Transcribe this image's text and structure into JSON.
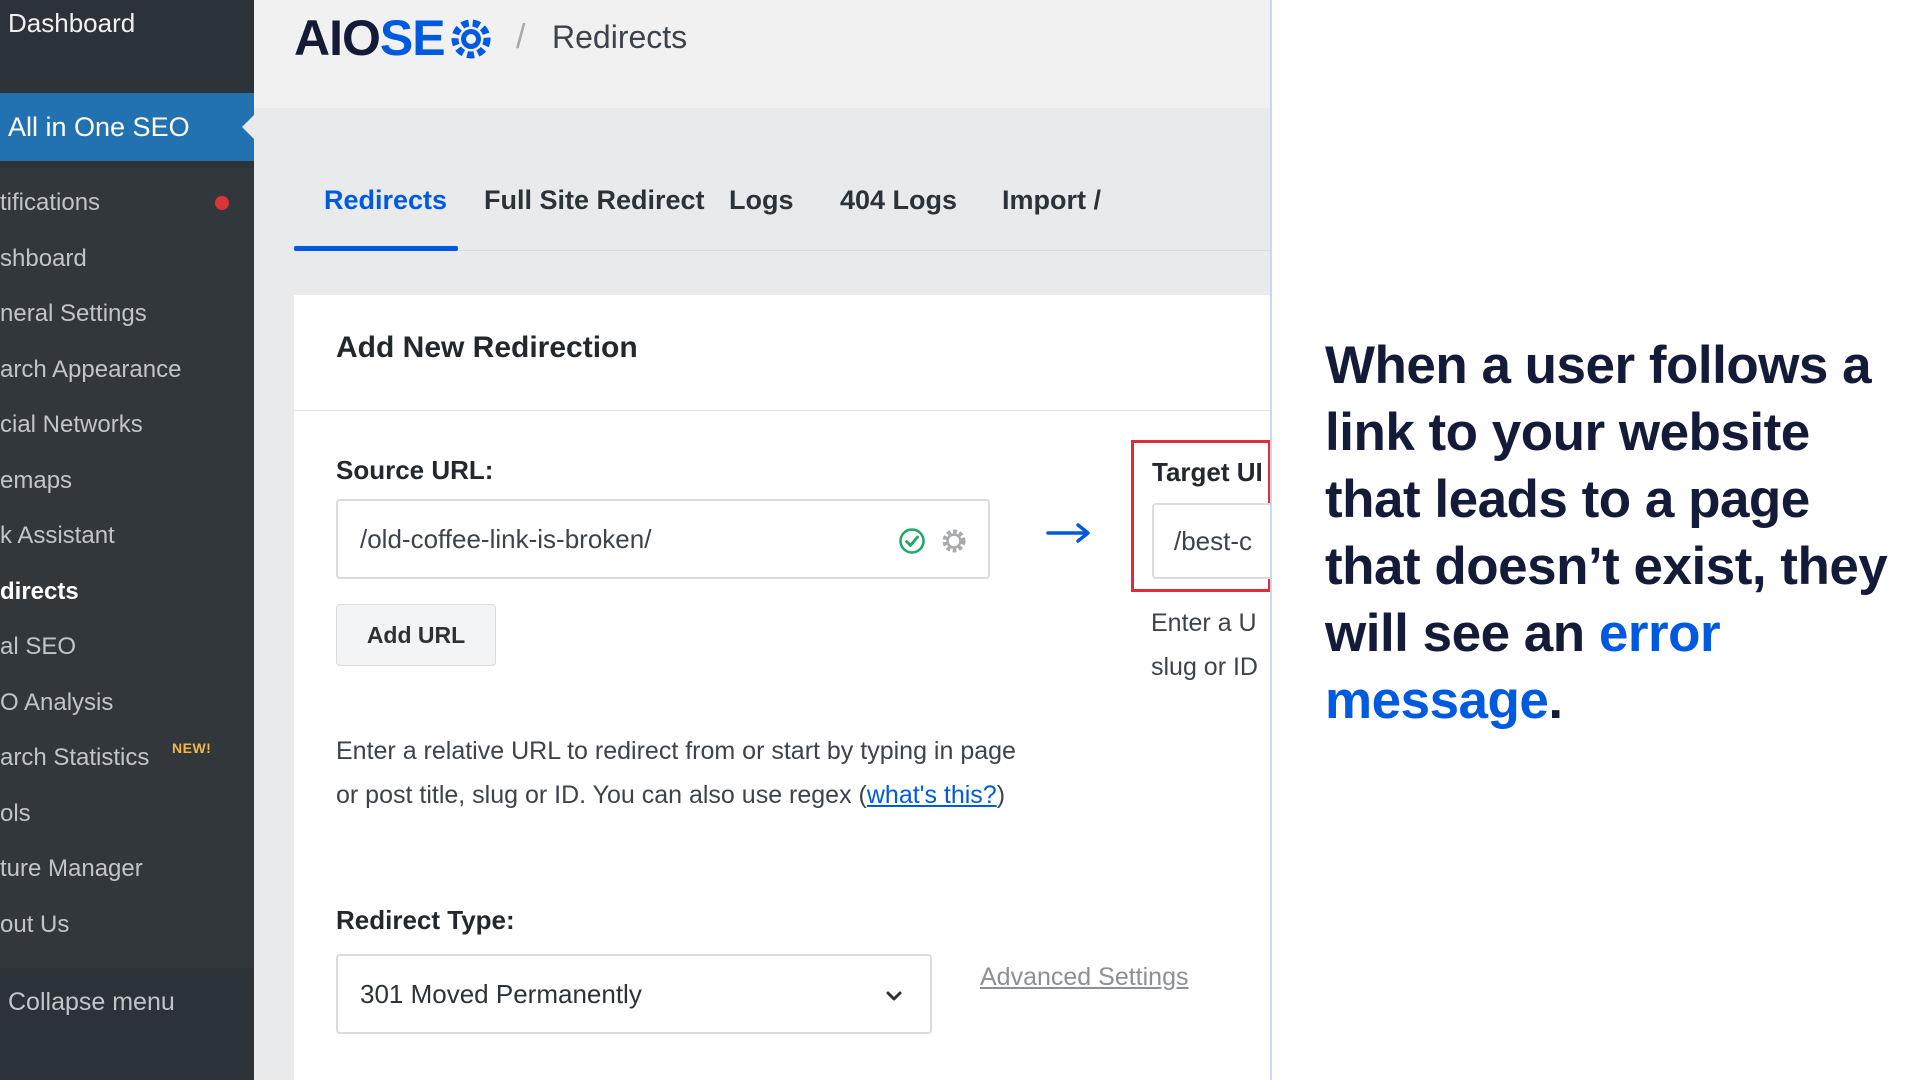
{
  "sidebar": {
    "dashboard": "Dashboard",
    "plugin": "All in One SEO",
    "items": [
      {
        "label": "tifications",
        "dot": true
      },
      {
        "label": "shboard"
      },
      {
        "label": "neral Settings"
      },
      {
        "label": "arch Appearance"
      },
      {
        "label": "cial Networks"
      },
      {
        "label": "emaps"
      },
      {
        "label": "k Assistant"
      },
      {
        "label": "directs",
        "active": true
      },
      {
        "label": "al SEO"
      },
      {
        "label": "O Analysis"
      },
      {
        "label": "arch Statistics",
        "badge": "NEW!"
      },
      {
        "label": "ols"
      },
      {
        "label": "ture Manager"
      },
      {
        "label": "out Us"
      }
    ],
    "collapse": "Collapse menu"
  },
  "header": {
    "logo_aio": "AIO",
    "logo_seo": "SE",
    "separator": "/",
    "title": "Redirects"
  },
  "tabs": [
    "Redirects",
    "Full Site Redirect",
    "Logs",
    "404 Logs",
    "Import /"
  ],
  "card": {
    "title": "Add New Redirection",
    "source": {
      "label": "Source URL:",
      "value": "/old-coffee-link-is-broken/",
      "add_button": "Add URL",
      "help_before": "Enter a relative URL to redirect from or start by typing in page or post title, slug or ID. You can also use regex (",
      "help_link": "what's this?",
      "help_after": ")"
    },
    "target": {
      "label": "Target UI",
      "value": "/best-c",
      "help_line1": "Enter a U",
      "help_line2": "slug or ID"
    },
    "redirect_type": {
      "label": "Redirect Type:",
      "value": "301 Moved Permanently"
    },
    "advanced_settings": "Advanced Settings"
  },
  "overlay": {
    "text": "When a user follows a link to your website that leads to a page that doesn’t exist, they will see an ",
    "highlight": "error message",
    "end": "."
  },
  "colors": {
    "accent": "#005ae0",
    "sidebar_bg": "#2c3338",
    "sidebar_active": "#2271b1",
    "highlight_border": "#e02c3a",
    "success": "#1da867"
  }
}
